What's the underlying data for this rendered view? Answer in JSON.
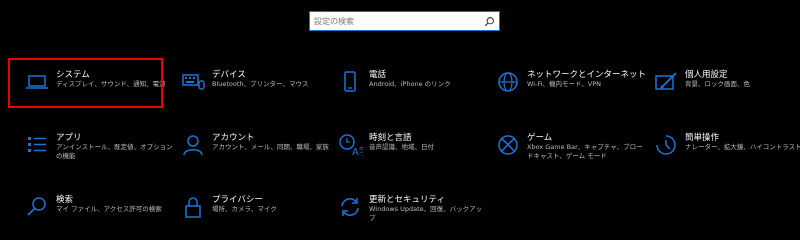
{
  "search": {
    "placeholder": "設定の検索"
  },
  "accent_color": "#1b74d8",
  "highlight_color": "#e00000",
  "tiles": [
    {
      "title": "システム",
      "subtitle": "ディスプレイ、サウンド、通知、電源",
      "icon": "laptop-icon"
    },
    {
      "title": "デバイス",
      "subtitle": "Bluetooth、プリンター、マウス",
      "icon": "keyboard-icon"
    },
    {
      "title": "電話",
      "subtitle": "Android、iPhone のリンク",
      "icon": "phone-icon"
    },
    {
      "title": "ネットワークとインターネット",
      "subtitle": "Wi-Fi、機内モード、VPN",
      "icon": "globe-icon"
    },
    {
      "title": "個人用設定",
      "subtitle": "背景、ロック画面、色",
      "icon": "paint-icon"
    },
    {
      "title": "アプリ",
      "subtitle": "アンインストール、既定値、オプションの機能",
      "icon": "apps-icon"
    },
    {
      "title": "アカウント",
      "subtitle": "アカウント、メール、同期、職場、家族",
      "icon": "person-icon"
    },
    {
      "title": "時刻と言語",
      "subtitle": "音声認識、地域、日付",
      "icon": "time-language-icon"
    },
    {
      "title": "ゲーム",
      "subtitle": "Xbox Game Bar、キャプチャ、ブロードキャスト、ゲーム モード",
      "icon": "xbox-icon"
    },
    {
      "title": "簡単操作",
      "subtitle": "ナレーター、拡大鏡、ハイコントラスト",
      "icon": "ease-of-access-icon"
    },
    {
      "title": "検索",
      "subtitle": "マイ ファイル、アクセス許可の検索",
      "icon": "search-icon"
    },
    {
      "title": "プライバシー",
      "subtitle": "場所、カメラ、マイク",
      "icon": "lock-icon"
    },
    {
      "title": "更新とセキュリティ",
      "subtitle": "Windows Update、回復、バックアップ",
      "icon": "sync-icon"
    }
  ]
}
